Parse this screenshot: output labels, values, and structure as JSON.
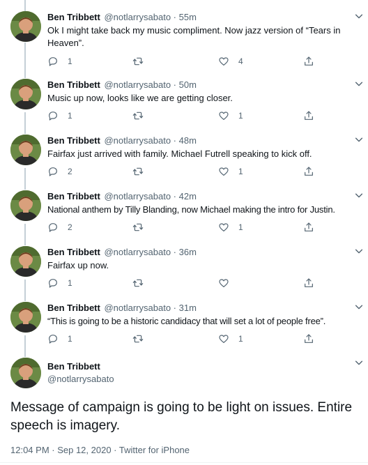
{
  "replies": [
    {
      "name": "Ben Tribbett",
      "handle": "@notlarrysabato",
      "sep": "·",
      "time": "55m",
      "text": "Ok I might take back my music compliment.  Now jazz version of “Tears in Heaven”.",
      "reply_count": "1",
      "retweet_count": "",
      "like_count": "4"
    },
    {
      "name": "Ben Tribbett",
      "handle": "@notlarrysabato",
      "sep": "·",
      "time": "50m",
      "text": "Music up now, looks like we are getting closer.",
      "reply_count": "1",
      "retweet_count": "",
      "like_count": "1"
    },
    {
      "name": "Ben Tribbett",
      "handle": "@notlarrysabato",
      "sep": "·",
      "time": "48m",
      "text": "Fairfax just arrived with family.  Michael Futrell speaking to kick off.",
      "reply_count": "2",
      "retweet_count": "",
      "like_count": "1"
    },
    {
      "name": "Ben Tribbett",
      "handle": "@notlarrysabato",
      "sep": "·",
      "time": "42m",
      "text": "National anthem by Tilly Blanding, now Michael making the intro for Justin.",
      "reply_count": "2",
      "retweet_count": "",
      "like_count": "1"
    },
    {
      "name": "Ben Tribbett",
      "handle": "@notlarrysabato",
      "sep": "·",
      "time": "36m",
      "text": "Fairfax up now.",
      "reply_count": "1",
      "retweet_count": "",
      "like_count": ""
    },
    {
      "name": "Ben Tribbett",
      "handle": "@notlarrysabato",
      "sep": "·",
      "time": "31m",
      "text": "“This is going to be a historic candidacy that will set a lot of people free”.",
      "reply_count": "1",
      "retweet_count": "",
      "like_count": "1"
    }
  ],
  "main_tweet": {
    "name": "Ben Tribbett",
    "handle": "@notlarrysabato",
    "text": "Message of campaign is going to be light on issues.  Entire speech is imagery.",
    "meta": "12:04 PM · Sep 12, 2020 · Twitter for iPhone"
  },
  "icons": {
    "reply": "reply-icon",
    "retweet": "retweet-icon",
    "like": "heart-icon",
    "share": "share-icon",
    "caret": "chevron-down-icon"
  },
  "colors": {
    "secondary_text": "#536471",
    "primary_text": "#0f1419",
    "thread_line": "#c4cfd6"
  }
}
